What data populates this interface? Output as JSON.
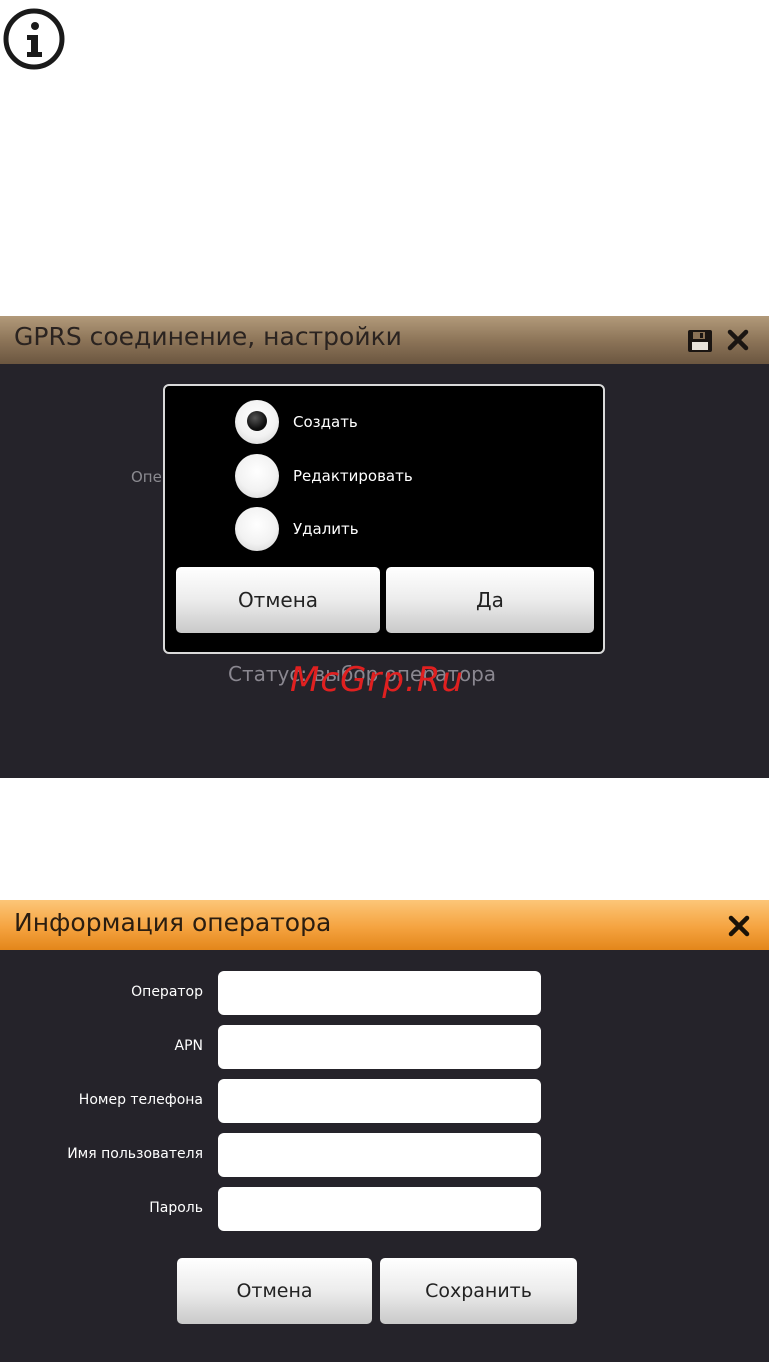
{
  "info": {
    "icon": "info-icon"
  },
  "gprs_screen": {
    "title": "GPRS соединение, настройки",
    "background_label_partial": "Опе",
    "status_text": "Статус: выбор оператора",
    "dialog": {
      "options": [
        {
          "label": "Создать",
          "selected": true
        },
        {
          "label": "Редактировать",
          "selected": false
        },
        {
          "label": "Удалить",
          "selected": false
        }
      ],
      "cancel_label": "Отмена",
      "yes_label": "Да"
    },
    "watermark": "McGrp.Ru"
  },
  "operator_screen": {
    "title": "Информация оператора",
    "fields": [
      {
        "label": "Оператор",
        "value": ""
      },
      {
        "label": "APN",
        "value": ""
      },
      {
        "label": "Номер телефона",
        "value": ""
      },
      {
        "label": "Имя пользователя",
        "value": ""
      },
      {
        "label": "Пароль",
        "value": ""
      }
    ],
    "cancel_label": "Отмена",
    "save_label": "Сохранить"
  },
  "colors": {
    "gprs_titlebar": "#8a7256",
    "operator_titlebar": "#f5a340",
    "screen_background": "#25232a",
    "watermark": "#e02020"
  }
}
